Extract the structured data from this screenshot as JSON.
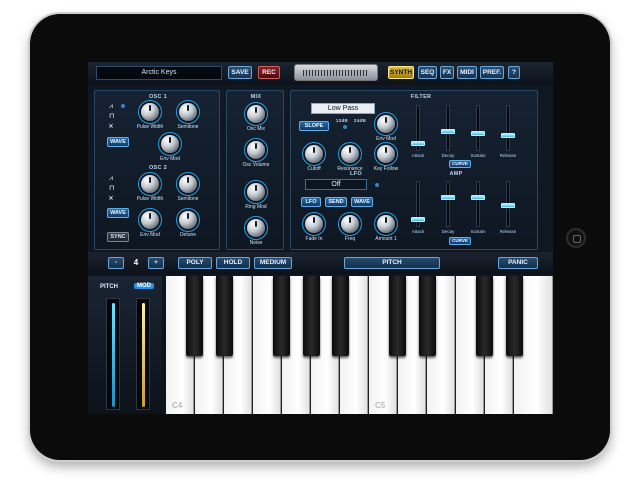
{
  "header": {
    "preset_name": "Arctic Keys",
    "save_label": "SAVE",
    "rec_label": "REC",
    "nav": [
      "SYNTH",
      "SEQ",
      "FX",
      "MIDI",
      "PREF.",
      "?"
    ]
  },
  "osc1": {
    "title": "OSC 1",
    "waveforms": [
      "⩘",
      "⊓",
      "⩙"
    ],
    "wave_button": "WAVE",
    "knobs": [
      "Pulse Width",
      "Semitone",
      "Env Mod"
    ]
  },
  "osc2": {
    "title": "OSC 2",
    "waveforms": [
      "⩘",
      "⊓",
      "⩙"
    ],
    "wave_button": "WAVE",
    "sync_button": "SYNC",
    "knobs": [
      "Pulse Width",
      "Semitone",
      "Env Mod",
      "Detune"
    ]
  },
  "mix": {
    "title": "MIX",
    "knobs": [
      "Osc Mix",
      "Osc Volume",
      "Ring Mod",
      "Noise"
    ]
  },
  "filter": {
    "title": "FILTER",
    "type_value": "Low Pass",
    "slope_button": "SLOPE",
    "slope_options": [
      "12dB",
      "24dB"
    ],
    "knobs": [
      "Cutoff",
      "Resonance",
      "Key Follow",
      "Env Mod"
    ],
    "sliders": [
      "Attack",
      "Decay",
      "Sustain",
      "Release"
    ],
    "curve_button": "CURVE"
  },
  "lfo": {
    "title": "LFO",
    "value": "Off",
    "buttons": [
      "LFO",
      "SEND",
      "WAVE"
    ],
    "knobs": [
      "Fade In",
      "Freq",
      "Amount 1"
    ]
  },
  "amp": {
    "title": "AMP",
    "sliders": [
      "Attack",
      "Decay",
      "Sustain",
      "Release"
    ],
    "curve_button": "CURVE"
  },
  "controls": {
    "octave_down": "-",
    "octave_value": "4",
    "octave_up": "+",
    "poly": "POLY",
    "hold": "HOLD",
    "medium": "MEDIUM",
    "pitch": "PITCH",
    "panic": "PANIC"
  },
  "wheels": {
    "pitch_label": "PITCH",
    "mod_label": "MOD"
  },
  "keyboard": {
    "labels": [
      "C4",
      "C5"
    ]
  },
  "colors": {
    "accent_blue": "#2b9fe0",
    "active_gold": "#e0c24a",
    "rec_red": "#8a1e1e"
  }
}
